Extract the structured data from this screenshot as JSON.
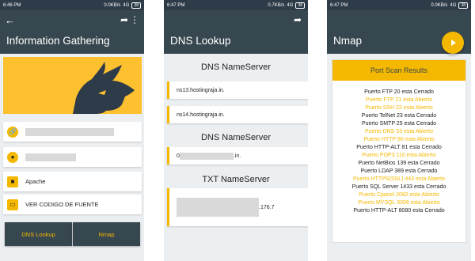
{
  "screen1": {
    "status": {
      "time": "6:46 PM",
      "speed": "0.0KB/s",
      "net": "4G",
      "battery": "38"
    },
    "title": "Information Gathering",
    "rows": [
      {
        "icon": "link-icon",
        "glyph": "🔗",
        "text": ""
      },
      {
        "icon": "location-pin-icon",
        "glyph": "●",
        "text": ""
      },
      {
        "icon": "server-icon",
        "glyph": "■",
        "text": "Apache"
      },
      {
        "icon": "code-icon",
        "glyph": "▭",
        "text": "VER CODIGO DE FUENTE"
      }
    ],
    "buttons": {
      "dns": "DNS Lookup",
      "nmap": "Nmap"
    }
  },
  "screen2": {
    "status": {
      "time": "6:47 PM",
      "speed": "0.7KB/s",
      "net": "4G",
      "battery": "38"
    },
    "title": "DNS Lookup",
    "sections": {
      "ns": "DNS NameServer",
      "ns2": "DNS NameServer",
      "txt": "TXT NameServer"
    },
    "ns_records": [
      "ns13.hostingraja.in.",
      "ns14.hostingraja.in."
    ],
    "dns_record": {
      "prefix": "0",
      "suffix": ".in."
    },
    "txt_record_suffix": ".176.7"
  },
  "screen3": {
    "status": {
      "time": "6:47 PM",
      "speed": "0.0KB/s",
      "net": "4G",
      "battery": "38"
    },
    "title": "Nmap",
    "results_title": "Port Scan Results",
    "ports": [
      {
        "pre": "Puerto FTP 20 ",
        "state": "esta Cerrado",
        "open": false
      },
      {
        "pre": "Puerto FTP 21 ",
        "state": "esta Abierto",
        "open": true
      },
      {
        "pre": "Puerto SSH 22 ",
        "state": "esta Abierto",
        "open": true
      },
      {
        "pre": "Puerto TelNet 23 ",
        "state": "esta Cerrado",
        "open": false
      },
      {
        "pre": "Puerto SMTP 25 ",
        "state": "esta Cerrado",
        "open": false
      },
      {
        "pre": "Puerto DNS 53 ",
        "state": "esta Abierto",
        "open": true
      },
      {
        "pre": "Puerto HTTP 80 ",
        "state": "esta Abierto",
        "open": true
      },
      {
        "pre": "Puerto HTTP-ALT 81 ",
        "state": "esta Cerrado",
        "open": false
      },
      {
        "pre": "Puerto POP3 110 ",
        "state": "esta Abierto",
        "open": true
      },
      {
        "pre": "Puerto NetBios 139 ",
        "state": "esta Cerrado",
        "open": false
      },
      {
        "pre": "Puerto LDAP 389 ",
        "state": "esta Cerrado",
        "open": false
      },
      {
        "pre": "Puerto HTTPS(SSL) 443 ",
        "state": "esta Abierto",
        "open": true
      },
      {
        "pre": "Puerto SQL Server 1433 ",
        "state": "esta Cerrado",
        "open": false
      },
      {
        "pre": "Puerto Cpanel 2082 ",
        "state": "esta Abierto",
        "open": true
      },
      {
        "pre": "Puerto MYSQL 3306 ",
        "state": "esta Abierto",
        "open": true
      },
      {
        "pre": "Puerto HTTP-ALT 8080 ",
        "state": "esta Cerrado",
        "open": false
      }
    ]
  },
  "colors": {
    "appbar": "#37474f",
    "accent": "#f5b800",
    "statusbar": "#2e3b48"
  }
}
